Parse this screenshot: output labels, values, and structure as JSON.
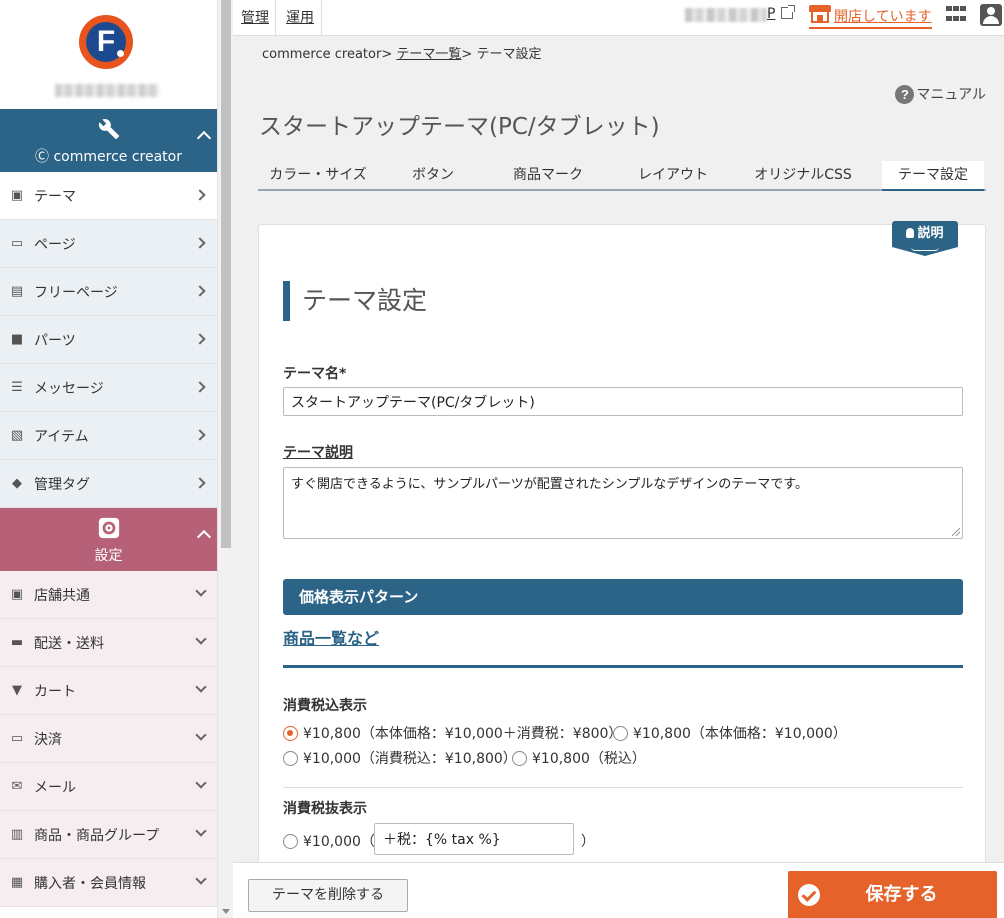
{
  "topbar": {
    "link_admin": "管理",
    "link_ops": "運用",
    "shop_link_suffix": "P",
    "shop_status": "開店しています",
    "icons": [
      "external-link-icon",
      "store-icon",
      "apps-grid-icon",
      "user-icon"
    ]
  },
  "sidebar": {
    "group_cc": {
      "label": "commerce creator",
      "icon": "wrench-icon"
    },
    "cc_items": [
      {
        "label": "テーマ",
        "icon": "theme-icon"
      },
      {
        "label": "ページ",
        "icon": "page-icon"
      },
      {
        "label": "フリーページ",
        "icon": "free-page-icon"
      },
      {
        "label": "パーツ",
        "icon": "parts-icon"
      },
      {
        "label": "メッセージ",
        "icon": "message-icon"
      },
      {
        "label": "アイテム",
        "icon": "image-icon"
      },
      {
        "label": "管理タグ",
        "icon": "tag-icon"
      }
    ],
    "group_settings": {
      "label": "設定",
      "icon": "gear-icon"
    },
    "settings_items": [
      {
        "label": "店舗共通",
        "icon": "monitor-icon"
      },
      {
        "label": "配送・送料",
        "icon": "truck-icon"
      },
      {
        "label": "カート",
        "icon": "cart-icon"
      },
      {
        "label": "決済",
        "icon": "credit-card-icon"
      },
      {
        "label": "メール",
        "icon": "mail-icon"
      },
      {
        "label": "商品・商品グループ",
        "icon": "product-icon"
      },
      {
        "label": "購入者・会員情報",
        "icon": "id-card-icon"
      }
    ]
  },
  "breadcrumb": {
    "root": "commerce creator",
    "sep": ">",
    "theme_list": "テーマ一覧",
    "current": "テーマ設定"
  },
  "manual_label": "マニュアル",
  "page_title": "スタートアップテーマ(PC/タブレット)",
  "tabs": [
    {
      "label": "カラー・サイズ"
    },
    {
      "label": "ボタン"
    },
    {
      "label": "商品マーク"
    },
    {
      "label": "レイアウト"
    },
    {
      "label": "オリジナルCSS"
    },
    {
      "label": "テーマ設定",
      "active": true
    }
  ],
  "panel": {
    "help_badge": "説明",
    "heading": "テーマ設定",
    "theme_name_label": "テーマ名*",
    "theme_name_value": "スタートアップテーマ(PC/タブレット)",
    "theme_desc_label": "テーマ説明",
    "theme_desc_value": "すぐ開店できるように、サンプルパーツが配置されたシンプルなデザインのテーマです。",
    "price_pattern_heading": "価格表示パターン",
    "product_list_heading": "商品一覧など",
    "tax_incl_label": "消費税込表示",
    "tax_incl_options": [
      {
        "label": "¥10,800（本体価格：¥10,000＋消費税：¥800）",
        "selected": true
      },
      {
        "label": "¥10,800（本体価格：¥10,000）",
        "selected": false
      },
      {
        "label": "¥10,000（消費税込：¥10,800）",
        "selected": false
      },
      {
        "label": "¥10,800（税込）",
        "selected": false
      }
    ],
    "tax_excl_label": "消費税抜表示",
    "tax_excl_option": "¥10,000（",
    "tax_excl_input": "＋税：{% tax %}",
    "tax_excl_close": "）"
  },
  "footer": {
    "delete_button": "テーマを削除する",
    "save_button": "保存する"
  },
  "colors": {
    "primary": "#2c6487",
    "accent": "#e5632a",
    "settings_group": "#b66178"
  }
}
